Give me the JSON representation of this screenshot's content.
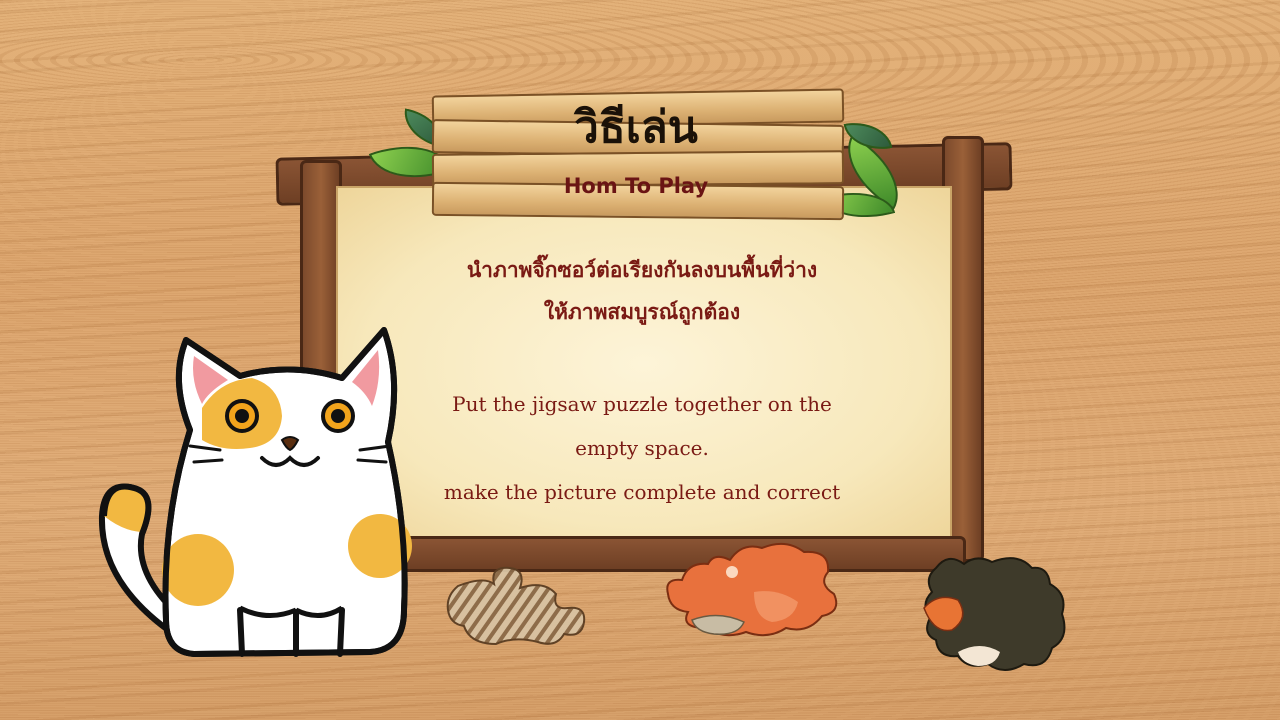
{
  "title": {
    "thai": "วิธีเล่น",
    "english": "Hom To Play"
  },
  "instructions": {
    "thai_line1": "นำภาพจิ๊กซอว์ต่อเรียงกันลงบนพื้นที่ว่าง",
    "thai_line2": "ให้ภาพสมบูรณ์ถูกต้อง",
    "english_line1": "Put the jigsaw puzzle together on the",
    "english_line2": "empty space.",
    "english_line3": "make the picture complete and correct"
  },
  "colors": {
    "wood_background": "#dba56d",
    "parchment": "#f7e8bb",
    "frame": "#7c4a2c",
    "text_red": "#7a1a14",
    "title_dark": "#1a1108"
  },
  "icons": [
    "cat-mascot",
    "puzzle-piece-wood",
    "puzzle-piece-orange",
    "puzzle-piece-dark"
  ]
}
